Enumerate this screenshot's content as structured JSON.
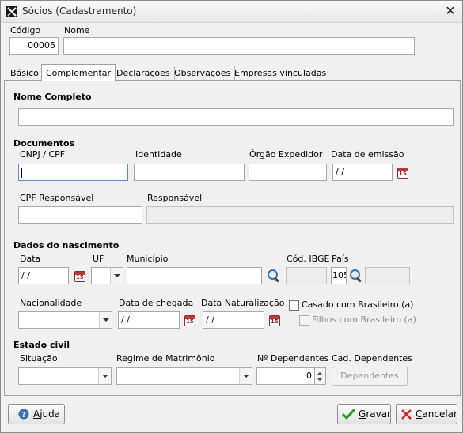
{
  "window": {
    "title": "Sócios (Cadastramento)"
  },
  "header": {
    "codigo_label": "Código",
    "codigo_value": "00005",
    "nome_label": "Nome",
    "nome_value": ""
  },
  "tabs": [
    {
      "label": "Básico",
      "active": false
    },
    {
      "label": "Complementar",
      "active": true
    },
    {
      "label": "Declarações",
      "active": false
    },
    {
      "label": "Observações",
      "active": false
    },
    {
      "label": "Empresas vinculadas",
      "active": false
    }
  ],
  "nome_completo": {
    "label": "Nome Completo",
    "value": ""
  },
  "documentos": {
    "heading": "Documentos",
    "cnpj_cpf_label": "CNPJ / CPF",
    "cnpj_cpf_value": "",
    "identidade_label": "Identidade",
    "identidade_value": "",
    "orgao_label": "Órgão Expedidor",
    "orgao_value": "",
    "data_emissao_label": "Data de emissão",
    "data_emissao_value": " /  /",
    "cpf_resp_label": "CPF Responsável",
    "cpf_resp_value": "",
    "responsavel_label": "Responsável",
    "responsavel_value": ""
  },
  "nascimento": {
    "heading": "Dados do nascimento",
    "data_label": "Data",
    "data_value": " /  /",
    "uf_label": "UF",
    "uf_value": "",
    "municipio_label": "Município",
    "municipio_value": "",
    "ibge_label": "Cód. IBGE",
    "ibge_value": "",
    "pais_label": "País",
    "pais_code": "105",
    "pais_name": "",
    "nacionalidade_label": "Nacionalidade",
    "nacionalidade_value": "",
    "chegada_label": "Data de chegada",
    "chegada_value": " /  /",
    "naturalizacao_label": "Data Naturalização",
    "naturalizacao_value": " /  /",
    "casado_label": "Casado com Brasileiro (a)",
    "filhos_label": "Filhos com Brasileiro (a)"
  },
  "estado_civil": {
    "heading": "Estado civil",
    "situacao_label": "Situação",
    "situacao_value": "",
    "regime_label": "Regime de Matrimônio",
    "regime_value": "",
    "dependentes_label": "Nº Dependentes",
    "dependentes_value": "0",
    "cad_dependentes_label": "Cad. Dependentes",
    "dependentes_button": "Dependentes"
  },
  "calendar_icon_text": "15",
  "footer": {
    "help_prefix": "",
    "help_accel": "A",
    "help_rest": "juda",
    "save_accel": "G",
    "save_rest": "ravar",
    "cancel_accel": "C",
    "cancel_rest": "ancelar"
  },
  "colors": {
    "accent": "#3b6fb0",
    "calendar": "#b83a3a",
    "save_check": "#2a9a2a",
    "cancel_x": "#c62828"
  },
  "icons": [
    "app-icon",
    "close-icon",
    "calendar-icon",
    "search-icon",
    "help-icon",
    "check-icon",
    "cancel-icon"
  ]
}
